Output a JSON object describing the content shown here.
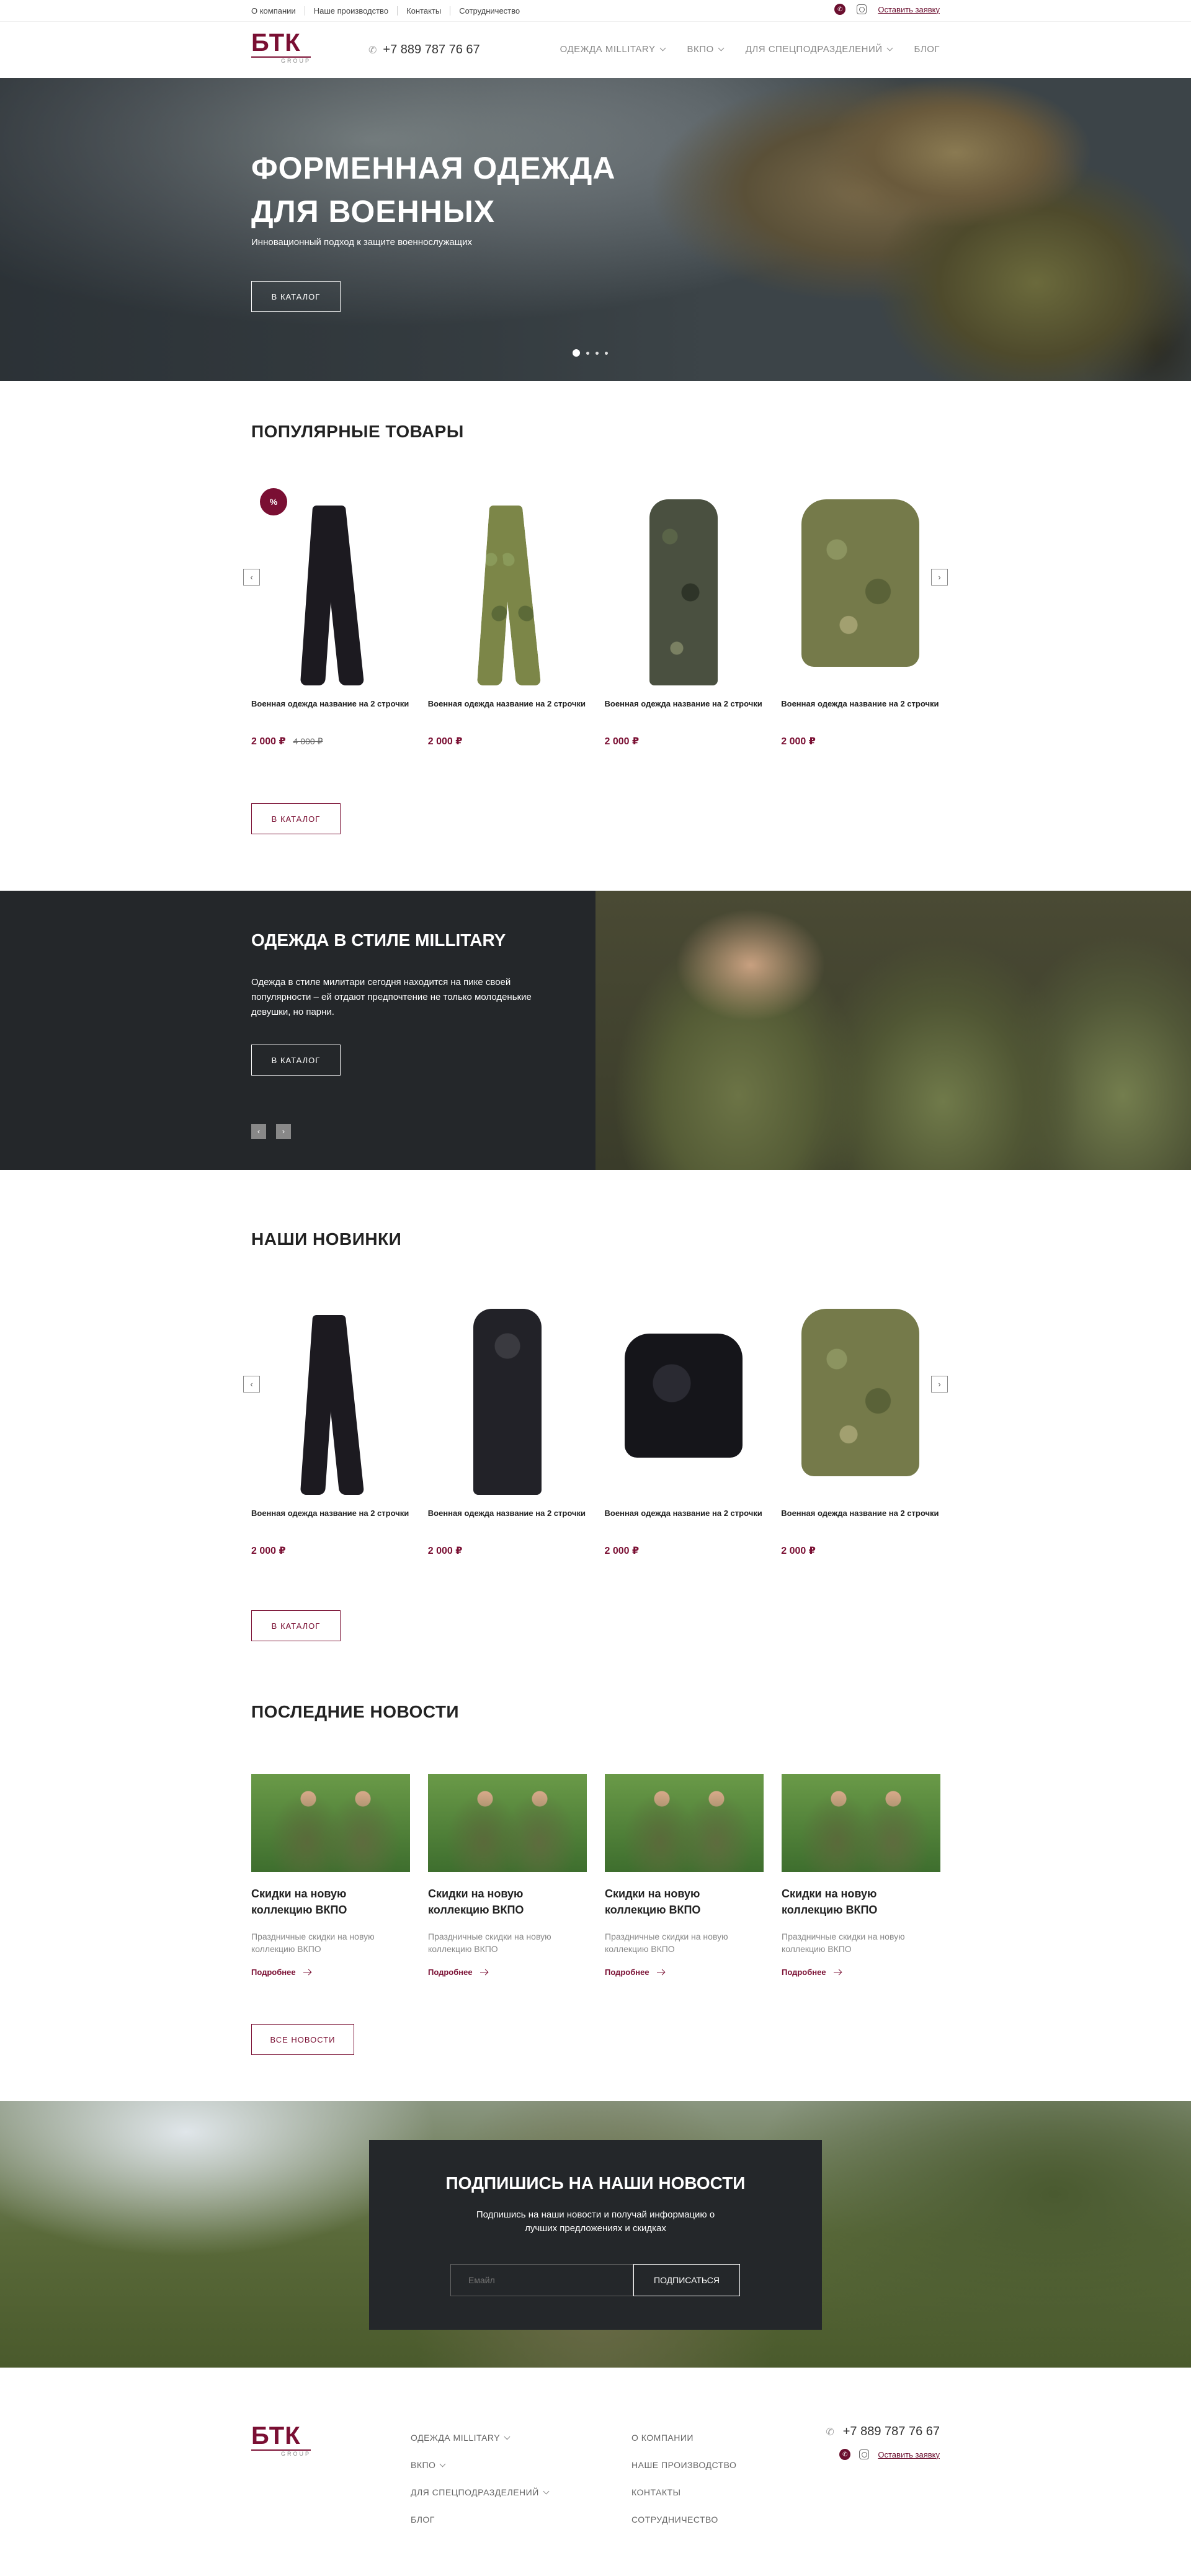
{
  "topbar": {
    "links": [
      "О компании",
      "Наше производство",
      "Контакты",
      "Сотрудничество"
    ],
    "request_label": "Оставить заявку"
  },
  "header": {
    "logo_main": "БТК",
    "logo_sub": "GROUP",
    "phone": "+7 889 787 76 67",
    "nav": [
      "ОДЕЖДА MILLITARY",
      "ВКПО",
      "ДЛЯ СПЕЦПОДРАЗДЕЛЕНИЙ",
      "БЛОГ"
    ]
  },
  "hero": {
    "title_line1": "ФОРМЕННАЯ ОДЕЖДА",
    "title_line2": "ДЛЯ ВОЕННЫХ",
    "subtitle": "Инновационный подход к защите военнослужащих",
    "button": "В КАТАЛОГ",
    "slides": 4,
    "active_slide": 1
  },
  "popular": {
    "title": "ПОПУЛЯРНЫЕ ТОВАРЫ",
    "items": [
      {
        "name": "Военная одежда название на 2 строчки",
        "price": "2 000 ₽",
        "old_price": "4 000 ₽",
        "badge": "%"
      },
      {
        "name": "Военная одежда название на 2 строчки",
        "price": "2 000 ₽"
      },
      {
        "name": "Военная одежда название на 2 строчки",
        "price": "2 000 ₽"
      },
      {
        "name": "Военная одежда название на 2 строчки",
        "price": "2 000 ₽"
      }
    ],
    "button": "В КАТАЛОГ"
  },
  "military": {
    "title": "ОДЕЖДА В СТИЛЕ MILLITARY",
    "text": "Одежда в стиле милитари сегодня находится на пике своей популярности – ей отдают предпочтение не только молоденькие девушки, но парни.",
    "button": "В КАТАЛОГ"
  },
  "novelties": {
    "title": "НАШИ НОВИНКИ",
    "items": [
      {
        "name": "Военная одежда название на 2 строчки",
        "price": "2 000 ₽"
      },
      {
        "name": "Военная одежда название на 2 строчки",
        "price": "2 000 ₽"
      },
      {
        "name": "Военная одежда название на 2 строчки",
        "price": "2 000 ₽"
      },
      {
        "name": "Военная одежда название на 2 строчки",
        "price": "2 000 ₽"
      }
    ],
    "button": "В КАТАЛОГ"
  },
  "news": {
    "title": "ПОСЛЕДНИЕ НОВОСТИ",
    "items": [
      {
        "title": "Скидки на новую коллекцию ВКПО",
        "text": "Праздничные скидки на новую коллекцию ВКПО",
        "more": "Подробнее"
      },
      {
        "title": "Скидки на новую коллекцию ВКПО",
        "text": "Праздничные скидки на новую коллекцию ВКПО",
        "more": "Подробнее"
      },
      {
        "title": "Скидки на новую коллекцию ВКПО",
        "text": "Праздничные скидки на новую коллекцию ВКПО",
        "more": "Подробнее"
      },
      {
        "title": "Скидки на новую коллекцию ВКПО",
        "text": "Праздничные скидки на новую коллекцию ВКПО",
        "more": "Подробнее"
      }
    ],
    "button": "ВСЕ НОВОСТИ"
  },
  "subscribe": {
    "title": "ПОДПИШИСЬ НА НАШИ НОВОСТИ",
    "text": "Подпишись на наши новости и получай информацию о лучших предложениях и скидках",
    "placeholder": "Емайл",
    "button": "ПОДПИСАТЬСЯ"
  },
  "footer": {
    "col1": [
      "ОДЕЖДА MILLITARY",
      "ВКПО",
      "ДЛЯ СПЕЦПОДРАЗДЕЛЕНИЙ",
      "БЛОГ"
    ],
    "col2": [
      "О КОМПАНИИ",
      "НАШЕ ПРОИЗВОДСТВО",
      "КОНТАКТЫ",
      "СОТРУДНИЧЕСТВО"
    ],
    "phone": "+7 889 787 76 67",
    "request_label": "Оставить заявку"
  },
  "colors": {
    "accent": "#7a0f33",
    "dark": "#24272a"
  }
}
